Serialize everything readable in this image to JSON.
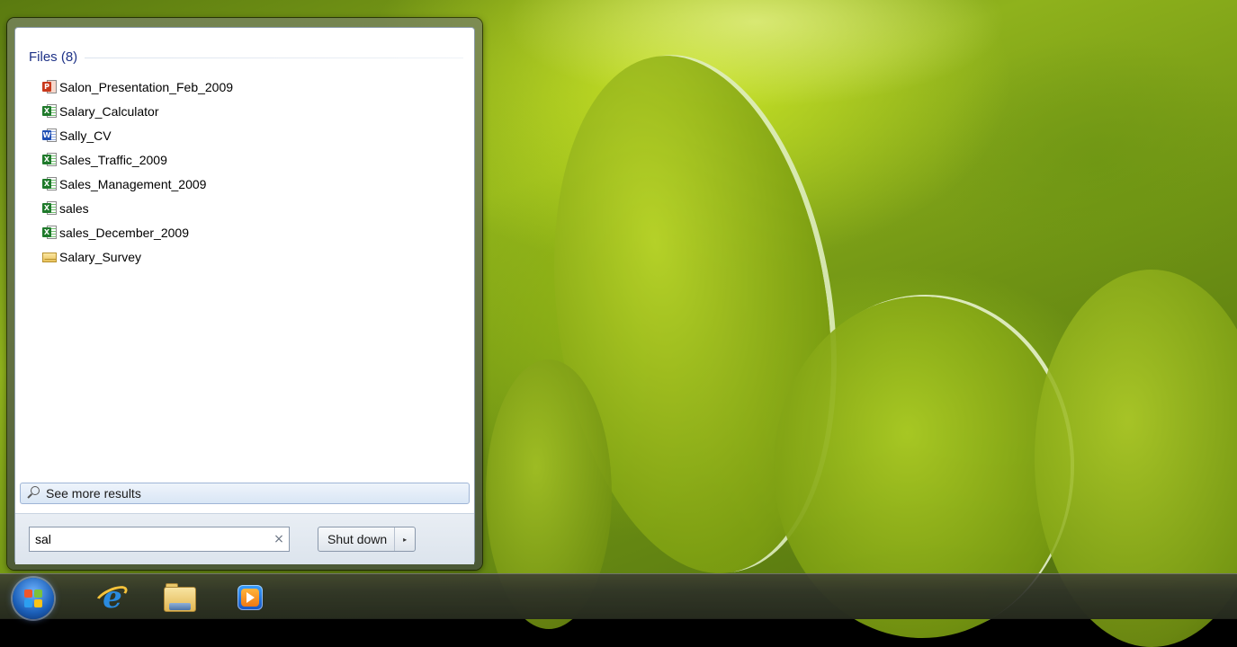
{
  "start_menu": {
    "group": {
      "title": "Files (8)"
    },
    "results": [
      {
        "label": "Salon_Presentation_Feb_2009",
        "type": "ppt"
      },
      {
        "label": "Salary_Calculator",
        "type": "excel"
      },
      {
        "label": "Sally_CV",
        "type": "word"
      },
      {
        "label": "Sales_Traffic_2009",
        "type": "excel"
      },
      {
        "label": "Sales_Management_2009",
        "type": "excel"
      },
      {
        "label": "sales",
        "type": "excel"
      },
      {
        "label": "sales_December_2009",
        "type": "excel"
      },
      {
        "label": "Salary_Survey",
        "type": "mail"
      }
    ],
    "see_more_label": "See more results",
    "search": {
      "value": "sal",
      "clear_glyph": "×"
    },
    "shutdown": {
      "label": "Shut down",
      "arrow_glyph": "▸"
    }
  },
  "taskbar": {
    "pinned": [
      {
        "name": "internet-explorer",
        "icon": "ie-icon"
      },
      {
        "name": "windows-explorer",
        "icon": "folder-icon"
      },
      {
        "name": "windows-media-player",
        "icon": "media-player-icon"
      }
    ]
  },
  "icons": {
    "start": "windows-flag-icon",
    "search": "magnifier-icon",
    "clear": "close-icon"
  },
  "colors": {
    "group_title": "#1e3287",
    "accent_blue": "#1b5fb8"
  }
}
